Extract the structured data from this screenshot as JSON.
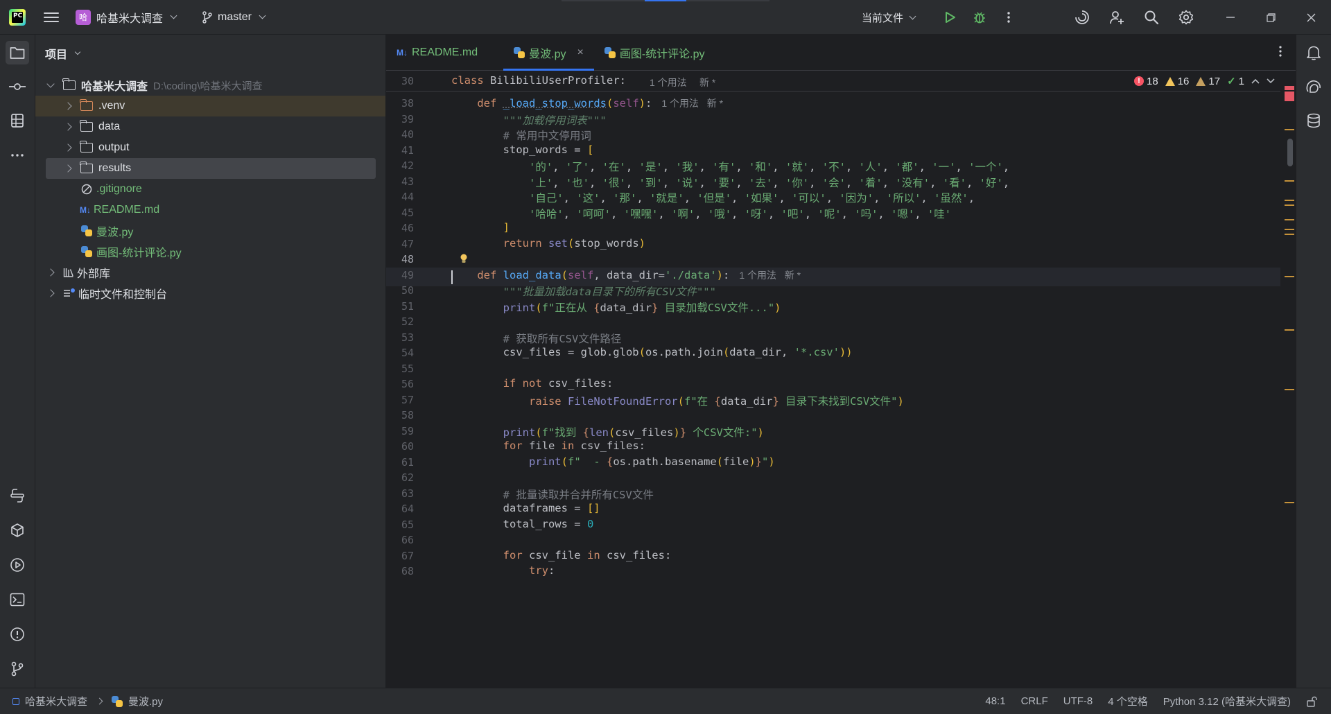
{
  "titlebar": {
    "project_badge": "哈",
    "project_name": "哈基米大调查",
    "branch": "master",
    "run_config": "当前文件"
  },
  "project_panel": {
    "title": "项目",
    "root": {
      "name": "哈基米大调查",
      "path": "D:\\coding\\哈基米大调查"
    },
    "items": [
      {
        "label": ".venv",
        "kind": "folder-excluded"
      },
      {
        "label": "data",
        "kind": "folder"
      },
      {
        "label": "output",
        "kind": "folder"
      },
      {
        "label": "results",
        "kind": "folder"
      },
      {
        "label": ".gitignore",
        "kind": "ignore-file"
      },
      {
        "label": "README.md",
        "kind": "markdown",
        "md_badge": "M↓"
      },
      {
        "label": "曼波.py",
        "kind": "python"
      },
      {
        "label": "画图-统计评论.py",
        "kind": "python"
      }
    ],
    "external_libs": "外部库",
    "scratches": "临时文件和控制台"
  },
  "tabs": [
    {
      "label": "README.md",
      "md_badge": "M↓"
    },
    {
      "label": "曼波.py",
      "close": "×"
    },
    {
      "label": "画图-统计评论.py"
    }
  ],
  "sticky": {
    "line": "30",
    "code": "class BilibiliUserProfiler:",
    "usages": "1 个用法",
    "new": "新 *"
  },
  "inspections": {
    "errors": "18",
    "warnings": "16",
    "weak_warnings": "17",
    "ok": "1"
  },
  "code_lines": [
    {
      "n": "38",
      "html": "    <span class='kw'>def</span> <span class='fn' style='text-decoration:underline dotted #6f737a'>_load_stop_words</span><span class='br'>(</span><span class='self'>self</span><span class='br'>)</span>:<span class='hint'>1 个用法&nbsp;&nbsp;&nbsp;新 *</span>"
    },
    {
      "n": "39",
      "html": "        <span class='doc'>\"\"\"加载停用词表\"\"\"</span>"
    },
    {
      "n": "40",
      "html": "        <span class='cmt'># 常用中文停用词</span>"
    },
    {
      "n": "41",
      "html": "        stop_words = <span class='br'>[</span>"
    },
    {
      "n": "42",
      "html": "            <span class='str'>'的'</span>, <span class='str'>'了'</span>, <span class='str'>'在'</span>, <span class='str'>'是'</span>, <span class='str'>'我'</span>, <span class='str'>'有'</span>, <span class='str'>'和'</span>, <span class='str'>'就'</span>, <span class='str'>'不'</span>, <span class='str'>'人'</span>, <span class='str'>'都'</span>, <span class='str'>'一'</span>, <span class='str'>'一个'</span>,"
    },
    {
      "n": "43",
      "html": "            <span class='str'>'上'</span>, <span class='str'>'也'</span>, <span class='str'>'很'</span>, <span class='str'>'到'</span>, <span class='str'>'说'</span>, <span class='str'>'要'</span>, <span class='str'>'去'</span>, <span class='str'>'你'</span>, <span class='str'>'会'</span>, <span class='str'>'着'</span>, <span class='str'>'没有'</span>, <span class='str'>'看'</span>, <span class='str'>'好'</span>,"
    },
    {
      "n": "44",
      "html": "            <span class='str'>'自己'</span>, <span class='str'>'这'</span>, <span class='str'>'那'</span>, <span class='str'>'就是'</span>, <span class='str'>'但是'</span>, <span class='str'>'如果'</span>, <span class='str'>'可以'</span>, <span class='str'>'因为'</span>, <span class='str'>'所以'</span>, <span class='str'>'虽然'</span>,"
    },
    {
      "n": "45",
      "html": "            <span class='str'>'哈哈'</span>, <span class='str'>'呵呵'</span>, <span class='str'>'嘿嘿'</span>, <span class='str'>'啊'</span>, <span class='str'>'哦'</span>, <span class='str'>'呀'</span>, <span class='str'>'吧'</span>, <span class='str'>'呢'</span>, <span class='str'>'吗'</span>, <span class='str'>'嗯'</span>, <span class='str'>'哇'</span>"
    },
    {
      "n": "46",
      "html": "        <span class='br'>]</span>"
    },
    {
      "n": "47",
      "html": "        <span class='kw'>return</span> <span class='bi'>set</span><span class='br'>(</span>stop_words<span class='br'>)</span>"
    },
    {
      "n": "48",
      "html": ""
    },
    {
      "n": "49",
      "html": "    <span class='kw'>def</span> <span class='fn'>load_data</span><span class='br'>(</span><span class='self'>self</span>, data_dir=<span class='str'>'./data'</span><span class='br'>)</span>:<span class='hint'>1 个用法&nbsp;&nbsp;&nbsp;新 *</span>"
    },
    {
      "n": "50",
      "html": "        <span class='doc'>\"\"\"批量加载data目录下的所有CSV文件\"\"\"</span>"
    },
    {
      "n": "51",
      "html": "        <span class='bi'>print</span><span class='br'>(</span><span class='str'>f\"正在从 </span><span class='kw'>{</span>data_dir<span class='kw'>}</span><span class='str'> 目录加载CSV文件...\"</span><span class='br'>)</span>"
    },
    {
      "n": "52",
      "html": ""
    },
    {
      "n": "53",
      "html": "        <span class='cmt'># 获取所有CSV文件路径</span>"
    },
    {
      "n": "54",
      "html": "        csv_files = glob.glob<span class='br'>(</span>os.path.join<span class='br'>(</span>data_dir, <span class='str'>'*.csv'</span><span class='br'>))</span>"
    },
    {
      "n": "55",
      "html": ""
    },
    {
      "n": "56",
      "html": "        <span class='kw'>if not</span> csv_files:"
    },
    {
      "n": "57",
      "html": "            <span class='kw'>raise</span> <span class='bi'>FileNotFoundError</span><span class='br'>(</span><span class='str'>f\"在 </span><span class='kw'>{</span>data_dir<span class='kw'>}</span><span class='str'> 目录下未找到CSV文件\"</span><span class='br'>)</span>"
    },
    {
      "n": "58",
      "html": ""
    },
    {
      "n": "59",
      "html": "        <span class='bi'>print</span><span class='br'>(</span><span class='str'>f\"找到 </span><span class='kw'>{</span><span class='bi'>len</span><span class='br'>(</span>csv_files<span class='br'>)</span><span class='kw'>}</span><span class='str'> 个CSV文件:\"</span><span class='br'>)</span>"
    },
    {
      "n": "60",
      "html": "        <span class='kw'>for</span> file <span class='kw'>in</span> csv_files:"
    },
    {
      "n": "61",
      "html": "            <span class='bi'>print</span><span class='br'>(</span><span class='str'>f\"  - </span><span class='kw'>{</span>os.path.basename<span class='br'>(</span>file<span class='br'>)</span><span class='kw'>}</span><span class='str'>\"</span><span class='br'>)</span>"
    },
    {
      "n": "62",
      "html": ""
    },
    {
      "n": "63",
      "html": "        <span class='cmt'># 批量读取并合并所有CSV文件</span>"
    },
    {
      "n": "64",
      "html": "        dataframes = <span class='br'>[]</span>"
    },
    {
      "n": "65",
      "html": "        total_rows = <span class='num'>0</span>"
    },
    {
      "n": "66",
      "html": ""
    },
    {
      "n": "67",
      "html": "        <span class='kw'>for</span> csv_file <span class='kw'>in</span> csv_files:"
    },
    {
      "n": "68",
      "html": "            <span class='kw'>try</span>:"
    }
  ],
  "statusbar": {
    "crumb_project": "哈基米大调查",
    "crumb_file": "曼波.py",
    "position": "48:1",
    "line_sep": "CRLF",
    "encoding": "UTF-8",
    "indent": "4 个空格",
    "interpreter": "Python 3.12 (哈基米大调查)"
  },
  "colors": {
    "accent": "#3574f0",
    "error": "#f75464",
    "warning": "#f2c55c",
    "added": "#73bd79"
  }
}
